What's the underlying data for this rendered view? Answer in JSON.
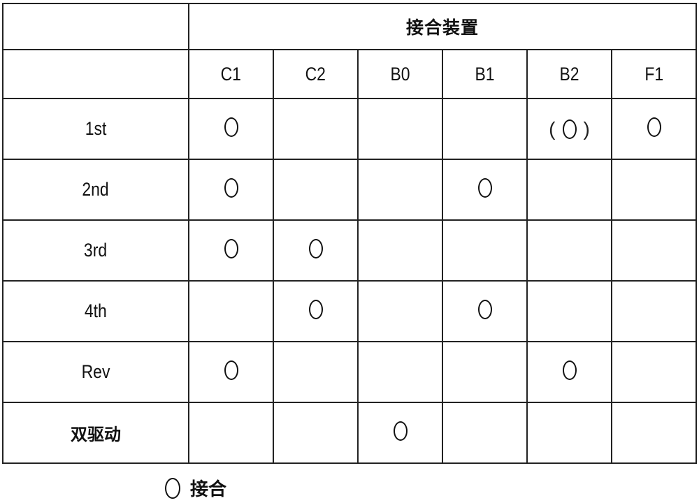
{
  "table": {
    "group_header": "接合装置",
    "columns": [
      "C1",
      "C2",
      "B0",
      "B1",
      "B2",
      "F1"
    ],
    "rows": [
      {
        "label": "1st",
        "bold": false,
        "cells": [
          "engaged",
          "",
          "",
          "",
          "engaged-optional",
          "engaged"
        ]
      },
      {
        "label": "2nd",
        "bold": false,
        "cells": [
          "engaged",
          "",
          "",
          "engaged",
          "",
          ""
        ]
      },
      {
        "label": "3rd",
        "bold": false,
        "cells": [
          "engaged",
          "engaged",
          "",
          "",
          "",
          ""
        ]
      },
      {
        "label": "4th",
        "bold": false,
        "cells": [
          "",
          "engaged",
          "",
          "engaged",
          "",
          ""
        ]
      },
      {
        "label": "Rev",
        "bold": false,
        "cells": [
          "engaged",
          "",
          "",
          "",
          "engaged",
          ""
        ]
      },
      {
        "label": "双驱动",
        "bold": true,
        "cells": [
          "",
          "",
          "engaged",
          "",
          "",
          ""
        ]
      }
    ],
    "mark_symbol": "circle-icon",
    "optional_brackets": [
      "(",
      ")"
    ]
  },
  "legend": {
    "symbol": "circle-icon",
    "label": "接合"
  }
}
